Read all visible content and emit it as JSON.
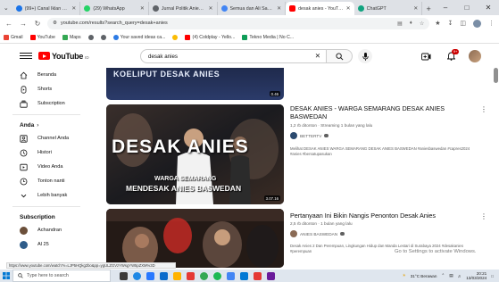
{
  "browser": {
    "tabs": [
      {
        "label": "(99+) Canal Iklan Publik dan...",
        "color": "#1a73e8",
        "active": false
      },
      {
        "label": "(29) WhatsApp",
        "color": "#25d366",
        "active": false
      },
      {
        "label": "Jurnal Politik Anies di...",
        "color": "#5f6368",
        "active": false
      },
      {
        "label": "Semua dan Ali Sadikin",
        "color": "#4285f4",
        "active": false
      },
      {
        "label": "desak anies - YouTube",
        "color": "#ff0000",
        "active": true
      },
      {
        "label": "ChatGPT",
        "color": "#10a37f",
        "active": false
      }
    ],
    "url": "youtube.com/results?search_query=desak+anies",
    "bookmarks": [
      {
        "label": "Gmail",
        "color": "#ea4335"
      },
      {
        "label": "YouTube",
        "color": "#ff0000"
      },
      {
        "label": "Maps",
        "color": "#34a853"
      },
      {
        "label": "",
        "color": "#5f6368"
      },
      {
        "label": "",
        "color": "#5f6368"
      },
      {
        "label": "Your saved ideas ca...",
        "color": "#2d7be5"
      },
      {
        "label": "",
        "color": "#fbbc04"
      },
      {
        "label": "(4) Coldplay - Yello...",
        "color": "#ff0000"
      },
      {
        "label": "Tekno Media | No C...",
        "color": "#0f9d58"
      }
    ]
  },
  "youtube": {
    "logo_text": "YouTube",
    "logo_region": "ID",
    "search_value": "desak anies",
    "notification_count": "9+"
  },
  "sidebar": {
    "top_items": [
      {
        "label": "Beranda",
        "icon": "home-icon"
      },
      {
        "label": "Shorts",
        "icon": "shorts-icon"
      },
      {
        "label": "Subscription",
        "icon": "subscriptions-icon"
      }
    ],
    "you_heading": "Anda",
    "you_items": [
      {
        "label": "Channel Anda",
        "icon": "channel-icon"
      },
      {
        "label": "Histori",
        "icon": "history-icon"
      },
      {
        "label": "Video Anda",
        "icon": "your-videos-icon"
      },
      {
        "label": "Tonton nanti",
        "icon": "watch-later-icon"
      },
      {
        "label": "Lebih banyak",
        "icon": "chevron-down-icon"
      }
    ],
    "subscriptions_heading": "Subscription",
    "subscriptions": [
      {
        "label": "Achandran",
        "color": "#6b4f3a"
      },
      {
        "label": "Al 25",
        "color": "#2f5d8a"
      }
    ]
  },
  "results": [
    {
      "thumb_text": "KOELIPUT DESAK ANIES",
      "duration": "0.46"
    },
    {
      "title": "DESAK ANIES - WARGA SEMARANG DESAK ANIES BASWEDAN",
      "meta": "1,2 rb ditonton · Streaming 1 bulan yang lalu",
      "channel": "BETTERTV",
      "description": "Melihat DESAK ANIES WARGA SEMARANG DESAK ANIES BASWEDAN #aniesbaswedan #capres2024 #anies #bersatupasukan",
      "thumb_big_text": "DESAK ANIES",
      "thumb_sub_1": "WARGA SEMARANG",
      "thumb_sub_2": "MENDESAK ANIES BASWEDAN",
      "duration": "3.07.16"
    },
    {
      "title": "Pertanyaan Ini Bikin Nangis Penonton Desak Anies",
      "meta": "2,5 rb ditonton · 1 bulan yang lalu",
      "channel": "ANIES BASWEDAN",
      "description": "Desak Anies 2 Dan Perempuan, Lingkungan Hidup dan Manda Lestari di Surabaya 2024 #desakanies #perempuan"
    }
  ],
  "overlay": {
    "activate_text": "Go to Settings to activate Windows.",
    "status_url": "https://www.youtube.com/watch?v=LJP5HQkg2bo&pp=ygULZGVzYWsgYW5pZXM%3D"
  },
  "taskbar": {
    "search_placeholder": "Type here to search",
    "weather": "31°C Berawan",
    "time": "20:21",
    "date": "13/03/2024",
    "app_colors": [
      "#3a3a3a",
      "#1e88e5",
      "#2979ff",
      "#0b6bcb",
      "#ffb300",
      "#e53935",
      "#34a853",
      "#1db954",
      "#4285f4",
      "#0078d4",
      "#e53935",
      "#6a1b9a"
    ]
  }
}
